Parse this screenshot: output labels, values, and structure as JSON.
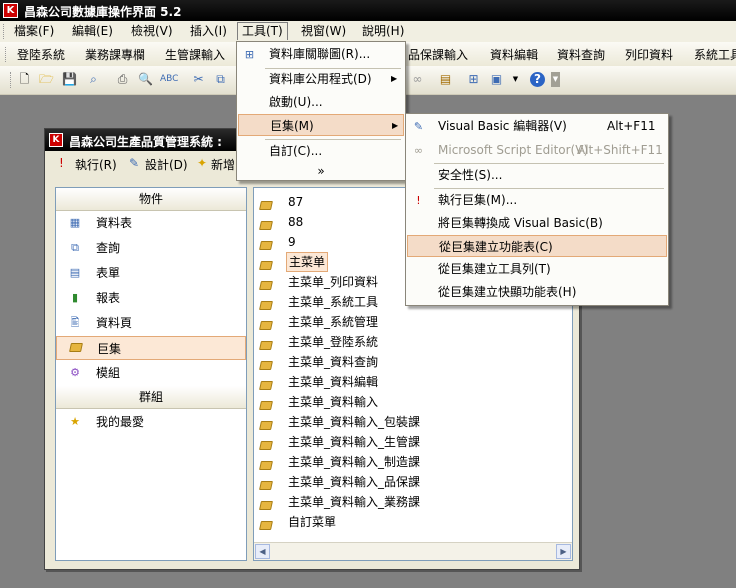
{
  "app": {
    "title": "昌森公司數據庫操作界面 5.2"
  },
  "menubar": {
    "items": [
      {
        "label": "檔案(F)"
      },
      {
        "label": "編輯(E)"
      },
      {
        "label": "檢視(V)"
      },
      {
        "label": "插入(I)"
      },
      {
        "label": "工具(T)"
      },
      {
        "label": "視窗(W)"
      },
      {
        "label": "說明(H)"
      }
    ]
  },
  "commandbar": {
    "items": [
      {
        "label": "登陸系統"
      },
      {
        "label": "業務課專欄"
      },
      {
        "label": "生管課輸入"
      },
      {
        "label": "品保課輸入"
      },
      {
        "label": "資料編輯"
      },
      {
        "label": "資料查詢"
      },
      {
        "label": "列印資料"
      },
      {
        "label": "系統工具"
      }
    ]
  },
  "db_window": {
    "title": "昌森公司生產品質管理系統 :",
    "toolbar": {
      "run": "執行(R)",
      "design": "設計(D)",
      "new": "新增"
    },
    "objects_header": "物件",
    "objects": [
      {
        "label": "資料表",
        "icon": "table-icon"
      },
      {
        "label": "查詢",
        "icon": "query-icon"
      },
      {
        "label": "表單",
        "icon": "form-icon"
      },
      {
        "label": "報表",
        "icon": "report-icon"
      },
      {
        "label": "資料頁",
        "icon": "page-icon"
      },
      {
        "label": "巨集",
        "icon": "macro-icon",
        "selected": true
      },
      {
        "label": "模組",
        "icon": "module-icon"
      }
    ],
    "groups_header": "群組",
    "groups": [
      {
        "label": "我的最愛",
        "icon": "favorites-icon"
      }
    ],
    "macros": [
      "87",
      "88",
      "9",
      "主菜单",
      "主菜单_列印資料",
      "主菜单_系統工具",
      "主菜单_系統管理",
      "主菜单_登陸系統",
      "主菜单_資料查詢",
      "主菜单_資料編輯",
      "主菜单_資料輸入",
      "主菜单_資料輸入_包裝課",
      "主菜单_資料輸入_生管課",
      "主菜单_資料輸入_制造課",
      "主菜单_資料輸入_品保課",
      "主菜单_資料輸入_業務課",
      "自訂菜單"
    ]
  },
  "tools_menu": {
    "items": [
      {
        "label": "資料庫關聯圖(R)..."
      },
      {
        "label": "資料庫公用程式(D)"
      },
      {
        "label": "啟動(U)..."
      },
      {
        "label": "巨集(M)"
      },
      {
        "label": "自訂(C)..."
      }
    ],
    "more": "»"
  },
  "macro_submenu": {
    "items": [
      {
        "label": "Visual Basic 編輯器(V)",
        "shortcut": "Alt+F11"
      },
      {
        "label": "Microsoft Script Editor(V)",
        "shortcut": "Alt+Shift+F11",
        "disabled": true
      },
      {
        "label": "安全性(S)..."
      },
      {
        "label": "執行巨集(M)..."
      },
      {
        "label": "將巨集轉換成 Visual Basic(B)"
      },
      {
        "label": "從巨集建立功能表(C)"
      },
      {
        "label": "從巨集建立工具列(T)"
      },
      {
        "label": "從巨集建立快顯功能表(H)"
      }
    ]
  },
  "colors": {
    "highlight": "#f4dcc8",
    "highlight_border": "#e3a977",
    "titlebar": "#000000",
    "menubar": "#f1efe2"
  }
}
